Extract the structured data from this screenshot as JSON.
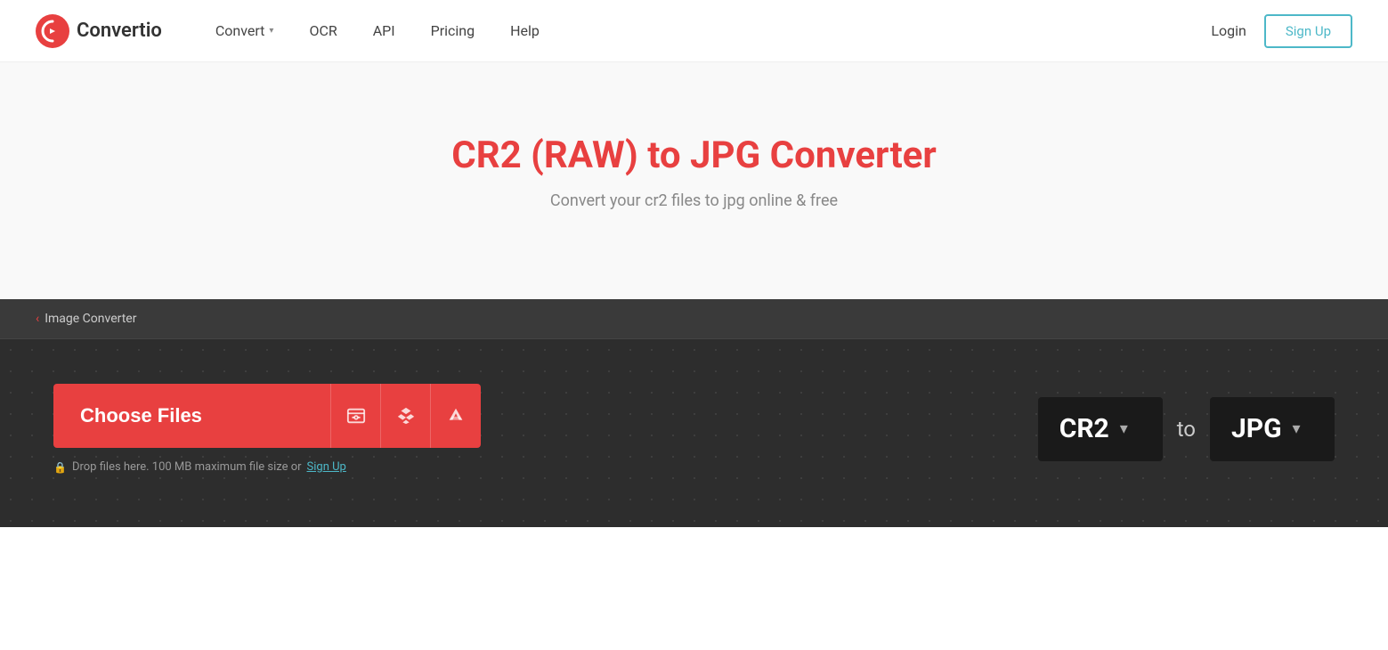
{
  "nav": {
    "logo_text": "Convertio",
    "links": [
      {
        "id": "convert",
        "label": "Convert",
        "has_dropdown": true
      },
      {
        "id": "ocr",
        "label": "OCR",
        "has_dropdown": false
      },
      {
        "id": "api",
        "label": "API",
        "has_dropdown": false
      },
      {
        "id": "pricing",
        "label": "Pricing",
        "has_dropdown": false
      },
      {
        "id": "help",
        "label": "Help",
        "has_dropdown": false
      }
    ],
    "login_label": "Login",
    "signup_label": "Sign Up"
  },
  "hero": {
    "title": "CR2 (RAW) to JPG Converter",
    "subtitle": "Convert your cr2 files to jpg online & free"
  },
  "converter": {
    "breadcrumb_label": "Image Converter",
    "choose_files_label": "Choose Files",
    "drop_hint_prefix": "Drop files here. 100 MB maximum file size or",
    "drop_hint_link": "Sign Up",
    "source_format": "CR2",
    "to_label": "to",
    "target_format": "JPG",
    "icons": {
      "folder_search": "📁",
      "dropbox": "◈",
      "drive": "▲"
    }
  }
}
